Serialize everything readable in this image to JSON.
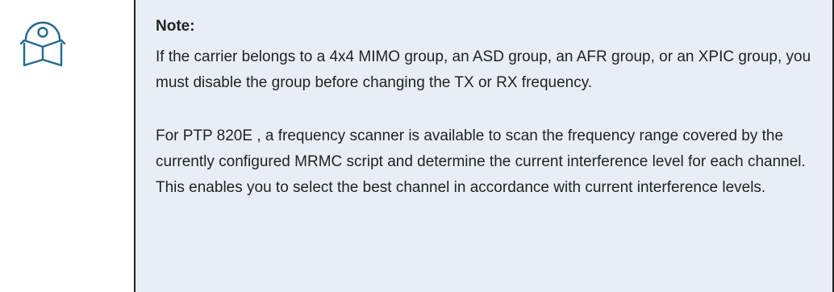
{
  "note": {
    "icon": "book-with-disc-icon",
    "title": "Note:",
    "paragraphs": [
      "If the carrier belongs to a 4x4 MIMO group, an ASD group, an AFR group, or an XPIC group, you must disable the group before changing the TX or RX frequency.",
      "For PTP 820E , a frequency scanner is available to scan the frequency range covered by the currently configured MRMC script and determine the current interference level for each channel. This enables you to select the best channel in accordance with current interference levels."
    ]
  },
  "colors": {
    "note_background": "#e9eef6",
    "border": "#222222",
    "icon_stroke": "#1f6b96",
    "text": "#222222"
  }
}
